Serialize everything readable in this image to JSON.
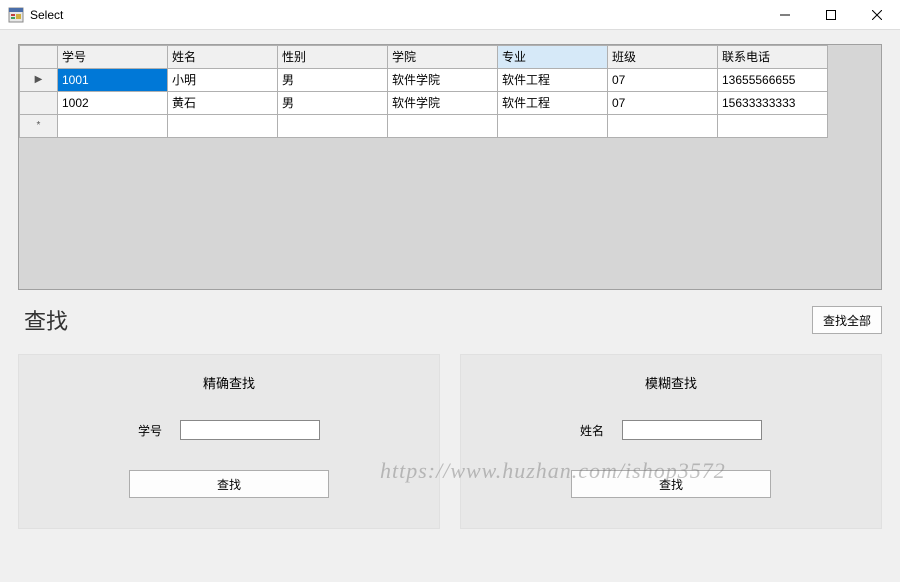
{
  "window": {
    "title": "Select"
  },
  "grid": {
    "columns": [
      "学号",
      "姓名",
      "性别",
      "学院",
      "专业",
      "班级",
      "联系电话"
    ],
    "selectedColumnIndex": 4,
    "rows": [
      {
        "selected": true,
        "cells": [
          "1001",
          "小明",
          "男",
          "软件学院",
          "软件工程",
          "07",
          "13655566655"
        ]
      },
      {
        "selected": false,
        "cells": [
          "1002",
          "黄石",
          "男",
          "软件学院",
          "软件工程",
          "07",
          "15633333333"
        ]
      }
    ],
    "newRowMarker": "*",
    "currentRowMarker": "▶"
  },
  "search": {
    "sectionTitle": "查找",
    "viewAllLabel": "查找全部",
    "exact": {
      "title": "精确查找",
      "fieldLabel": "学号",
      "value": "",
      "buttonLabel": "查找"
    },
    "fuzzy": {
      "title": "模糊查找",
      "fieldLabel": "姓名",
      "value": "",
      "buttonLabel": "查找"
    }
  },
  "watermark": "https://www.huzhan.com/ishop3572"
}
